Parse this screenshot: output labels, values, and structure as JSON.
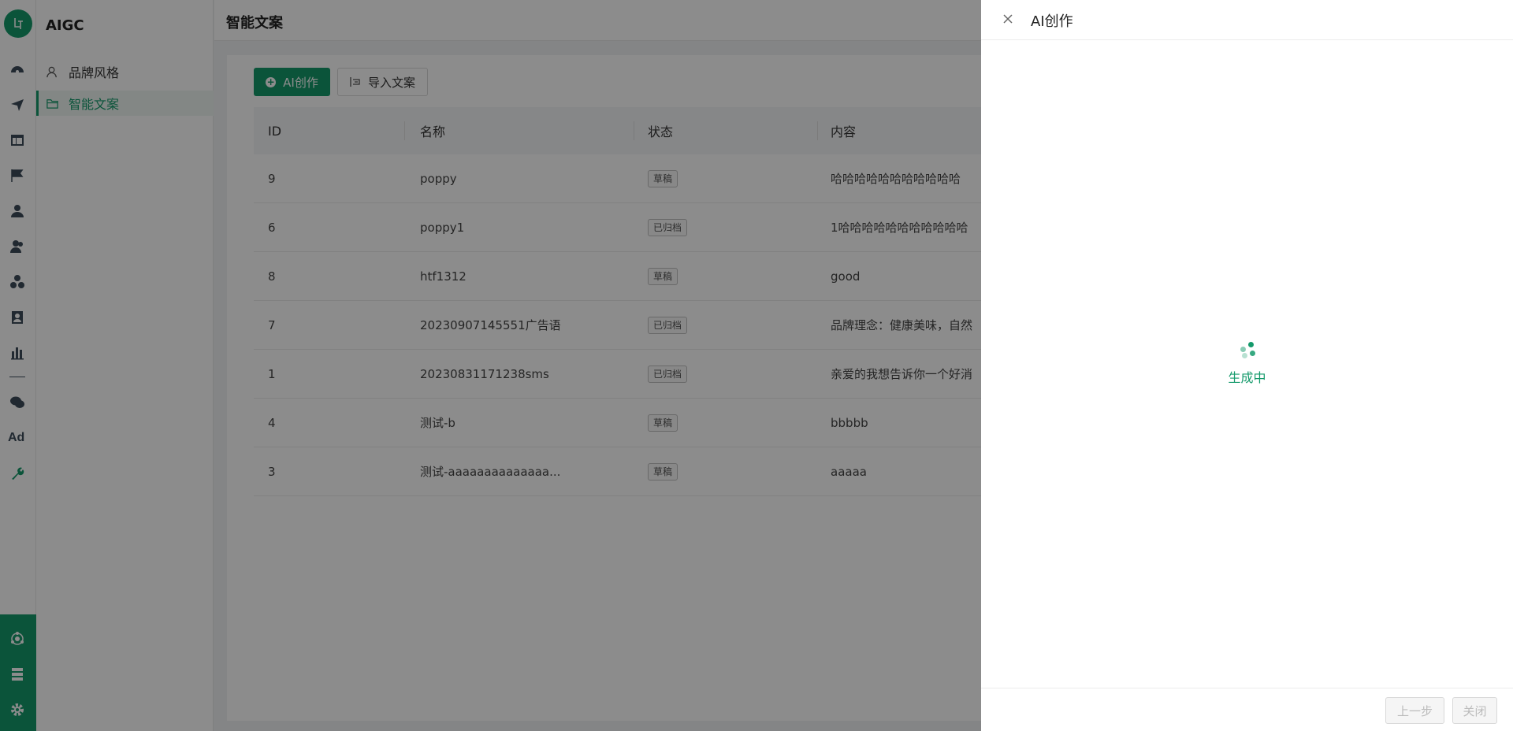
{
  "app": {
    "title": "AIGC"
  },
  "menu": {
    "items": [
      {
        "label": "品牌风格",
        "icon": "user-icon",
        "active": false
      },
      {
        "label": "智能文案",
        "icon": "folder-icon",
        "active": true
      }
    ]
  },
  "rail": {
    "icons": [
      "dashboard-icon",
      "send-icon",
      "layout-icon",
      "flag-icon",
      "user-icon",
      "users-icon",
      "cluster-icon",
      "contacts-icon",
      "bar-chart-icon",
      "wechat-icon",
      "ad-icon",
      "tool-icon"
    ],
    "ad_label": "Ad",
    "bottom_icons": [
      "network-icon",
      "database-icon",
      "settings-icon"
    ]
  },
  "header": {
    "title": "智能文案"
  },
  "toolbar": {
    "ai_create_label": "AI创作",
    "import_label": "导入文案"
  },
  "table": {
    "columns": [
      "ID",
      "名称",
      "状态",
      "内容"
    ],
    "rows": [
      {
        "id": "9",
        "name": "poppy",
        "status": "草稿",
        "content": "哈哈哈哈哈哈哈哈哈哈哈"
      },
      {
        "id": "6",
        "name": "poppy1",
        "status": "已归档",
        "content": "1哈哈哈哈哈哈哈哈哈哈哈"
      },
      {
        "id": "8",
        "name": "htf1312",
        "status": "草稿",
        "content": "good"
      },
      {
        "id": "7",
        "name": "20230907145551广告语",
        "status": "已归档",
        "content": "品牌理念：健康美味，自然"
      },
      {
        "id": "1",
        "name": "20230831171238sms",
        "status": "已归档",
        "content": "亲爱的我想告诉你一个好消"
      },
      {
        "id": "4",
        "name": "测试-b",
        "status": "草稿",
        "content": "bbbbb"
      },
      {
        "id": "3",
        "name": "测试-aaaaaaaaaaaaaa...",
        "status": "草稿",
        "content": "aaaaa"
      }
    ]
  },
  "drawer": {
    "title": "AI创作",
    "loading_text": "生成中",
    "prev_label": "上一步",
    "close_label": "关闭"
  },
  "colors": {
    "primary": "#149a6b",
    "mask": "rgba(0,0,0,0.45)"
  }
}
